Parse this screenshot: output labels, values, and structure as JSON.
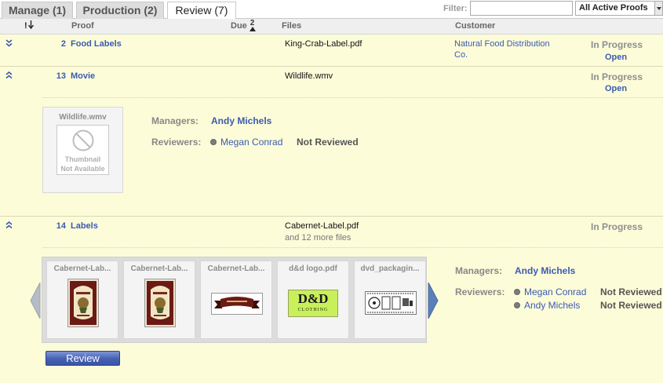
{
  "tabs": [
    {
      "label": "Manage (1)",
      "active": false
    },
    {
      "label": "Production (2)",
      "active": false
    },
    {
      "label": "Review (7)",
      "active": true
    }
  ],
  "filter": {
    "label": "Filter:",
    "value": "",
    "placeholder": "",
    "select_value": "All Active Proofs"
  },
  "columns": {
    "sort": "!",
    "proof": "Proof",
    "due": "Due",
    "due_sort_num": "2",
    "files": "Files",
    "customer": "Customer"
  },
  "rows": [
    {
      "expander": "collapsed",
      "num": "2",
      "name": "Food Labels",
      "file": "King-Crab-Label.pdf",
      "customer": "Natural Food Distribution Co.",
      "status": "In Progress",
      "action": "Open"
    },
    {
      "expander": "expanded",
      "num": "13",
      "name": "Movie",
      "file": "Wildlife.wmv",
      "customer": "",
      "status": "In Progress",
      "action": "Open",
      "detail": {
        "thumb_title": "Wildlife.wmv",
        "thumb_unavailable_1": "Thumbnail",
        "thumb_unavailable_2": "Not Available",
        "managers_label": "Managers:",
        "managers": [
          "Andy Michels"
        ],
        "reviewers_label": "Reviewers:",
        "reviewers": [
          {
            "name": "Megan Conrad",
            "status": "Not Reviewed"
          }
        ]
      }
    },
    {
      "expander": "expanded",
      "num": "14",
      "name": "Labels",
      "file": "Cabernet-Label.pdf",
      "more_files": "and 12 more files",
      "customer": "",
      "status": "In Progress",
      "detail": {
        "thumbs": [
          {
            "title": "Cabernet-Lab...",
            "kind": "wine-label"
          },
          {
            "title": "Cabernet-Lab...",
            "kind": "wine-label"
          },
          {
            "title": "Cabernet-Lab...",
            "kind": "ribbon-banner"
          },
          {
            "title": "d&d logo.pdf",
            "kind": "dd-logo",
            "logo_text": "D&D",
            "logo_sub": "CLOTHING"
          },
          {
            "title": "dvd_packagin...",
            "kind": "dvd-layout"
          }
        ],
        "managers_label": "Managers:",
        "managers": [
          "Andy Michels"
        ],
        "reviewers_label": "Reviewers:",
        "reviewers": [
          {
            "name": "Megan Conrad",
            "status": "Not Reviewed"
          },
          {
            "name": "Andy Michels",
            "status": "Not Reviewed"
          }
        ],
        "review_button": "Review"
      }
    }
  ],
  "colors": {
    "row_bg": "#fdfcd9",
    "link": "#3a5bb0",
    "status_gray": "#8f8f8f",
    "button_blue": "#4560b3"
  }
}
